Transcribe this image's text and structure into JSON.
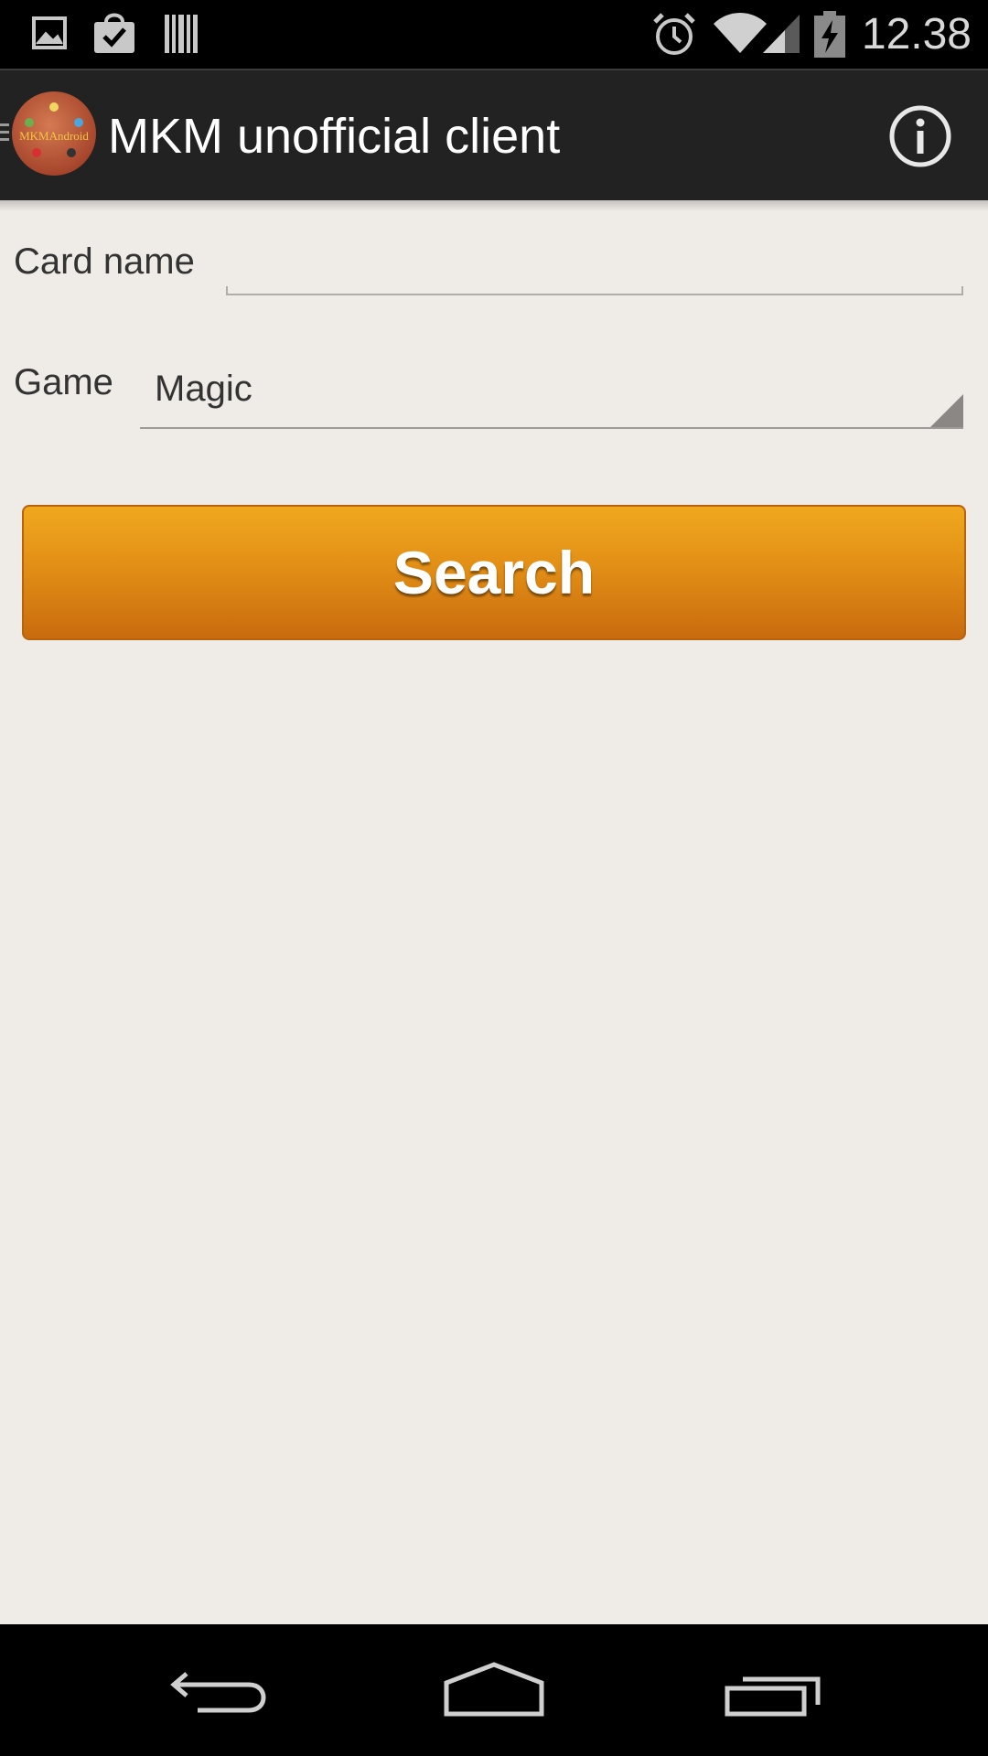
{
  "status_bar": {
    "time": "12.38",
    "left_icons": [
      "gallery-notification-icon",
      "play-store-update-icon",
      "barcode-notification-icon"
    ],
    "right_icons": [
      "alarm-icon",
      "wifi-icon",
      "cell-signal-icon",
      "battery-charging-icon"
    ]
  },
  "action_bar": {
    "title": "MKM unofficial client",
    "logo_text": "MKMAndroid",
    "info_icon": "info-icon",
    "background_color": "#222222"
  },
  "form": {
    "card_name_label": "Card name",
    "card_name_value": "",
    "game_label": "Game",
    "game_selected": "Magic"
  },
  "search_button": {
    "label": "Search",
    "color": "#e28f16"
  },
  "nav_bar": {
    "icons": [
      "back-icon",
      "home-icon",
      "recent-apps-icon"
    ]
  }
}
